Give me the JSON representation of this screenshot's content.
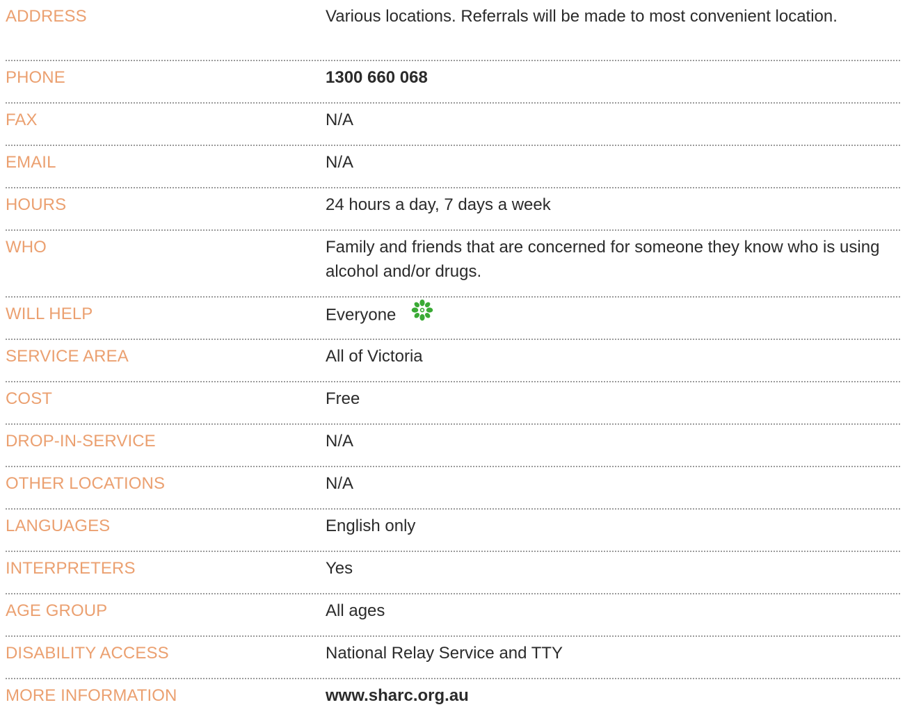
{
  "rows": [
    {
      "label": "ADDRESS",
      "value": "Various locations. Referrals will be made to most convenient location."
    },
    {
      "label": "PHONE",
      "value": "1300 660 068"
    },
    {
      "label": "FAX",
      "value": "N/A"
    },
    {
      "label": "EMAIL",
      "value": "N/A"
    },
    {
      "label": "HOURS",
      "value": "24 hours a day, 7 days a week"
    },
    {
      "label": "WHO",
      "value": "Family and friends that are concerned for someone they know who is using alcohol and/or drugs."
    },
    {
      "label": "WILL HELP",
      "value": "Everyone",
      "icon": "green-flower-icon"
    },
    {
      "label": "SERVICE AREA",
      "value": "All of Victoria"
    },
    {
      "label": "COST",
      "value": "Free"
    },
    {
      "label": "DROP-IN-SERVICE",
      "value": "N/A"
    },
    {
      "label": "OTHER LOCATIONS",
      "value": "N/A"
    },
    {
      "label": "LANGUAGES",
      "value": "English only"
    },
    {
      "label": "INTERPRETERS",
      "value": "Yes"
    },
    {
      "label": "AGE GROUP",
      "value": "All ages"
    },
    {
      "label": "DISABILITY ACCESS",
      "value": "National Relay Service and TTY"
    },
    {
      "label": "MORE INFORMATION",
      "value": "www.sharc.org.au"
    }
  ],
  "colors": {
    "label": "#eba070",
    "value": "#2b2b2b",
    "divider": "#9a9a9a",
    "icon": "#3aaa35"
  }
}
